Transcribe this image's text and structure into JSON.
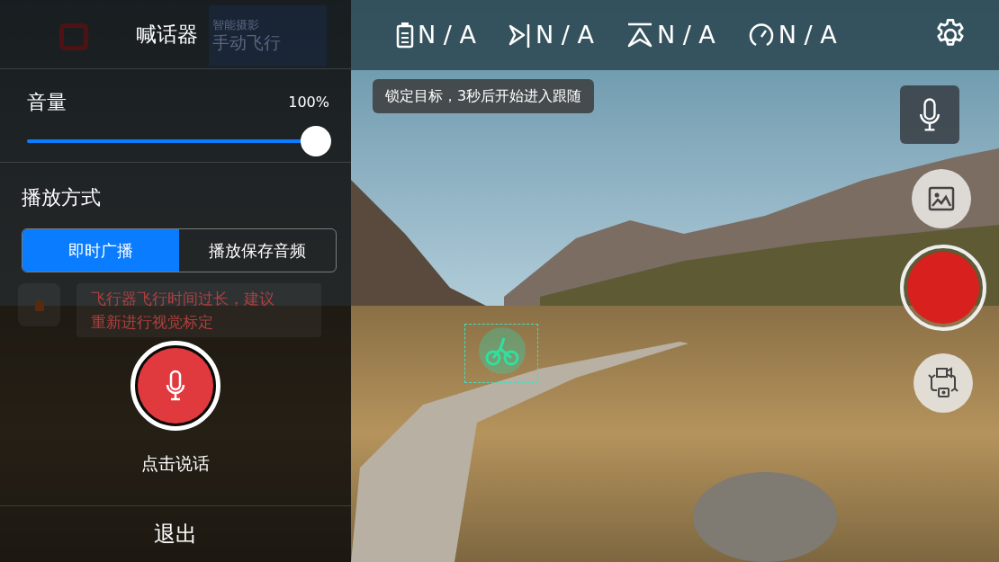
{
  "panel": {
    "title": "喊话器",
    "volume": {
      "label": "音量",
      "reading": "100%",
      "level": 1.0
    },
    "playback": {
      "label": "播放方式",
      "options": [
        {
          "label": "即时广播",
          "selected": true
        },
        {
          "label": "播放保存音频",
          "selected": false
        }
      ]
    },
    "talk": {
      "label": "点击说话"
    },
    "exit": {
      "label": "退出"
    }
  },
  "background_hud": {
    "mode": {
      "subtitle": "智能摄影",
      "title": "手动飞行"
    },
    "warning": {
      "lines": [
        "飞行器飞行时间过长，建议",
        "重新进行视觉标定"
      ]
    }
  },
  "status_bar": {
    "items": [
      {
        "kind": "battery",
        "value": "N / A"
      },
      {
        "kind": "distance",
        "value": "N / A"
      },
      {
        "kind": "altitude",
        "value": "N / A"
      },
      {
        "kind": "speed",
        "value": "N / A"
      }
    ]
  },
  "tooltip": "锁定目标，3秒后开始进入跟随"
}
